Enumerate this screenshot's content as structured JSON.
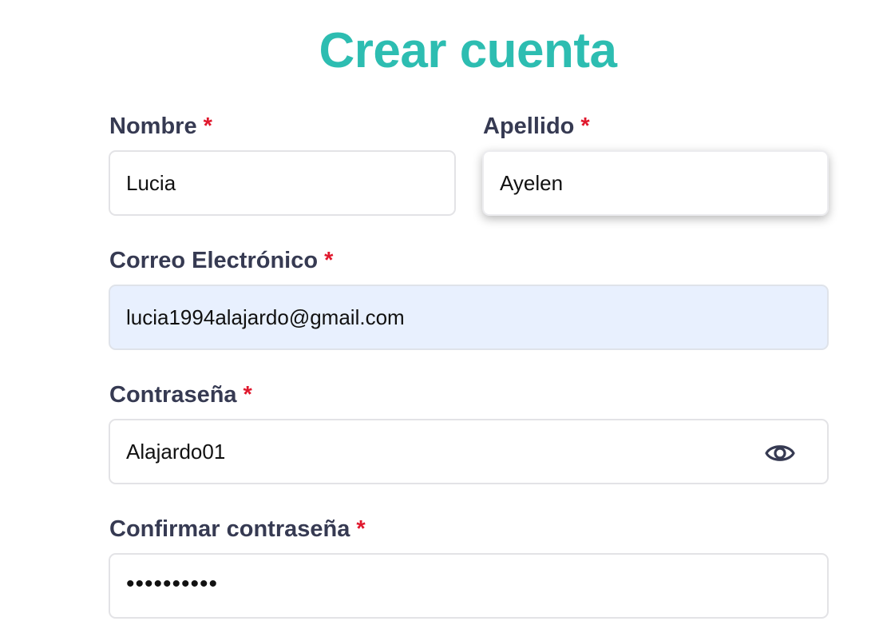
{
  "form": {
    "title": "Crear cuenta",
    "required_mark": "*",
    "nombre": {
      "label": "Nombre",
      "value": "Lucia"
    },
    "apellido": {
      "label": "Apellido",
      "value": "Ayelen"
    },
    "correo": {
      "label": "Correo Electrónico",
      "value": "lucia1994alajardo@gmail.com"
    },
    "contrasena": {
      "label": "Contraseña",
      "value": "Alajardo01",
      "toggle_icon": "eye-icon"
    },
    "confirmar": {
      "label": "Confirmar contraseña",
      "value": "••••••••••"
    }
  },
  "colors": {
    "title": "#2dbdb1",
    "label": "#363a52",
    "required": "#e0182d",
    "autofill_bg": "#e8f0fe"
  }
}
